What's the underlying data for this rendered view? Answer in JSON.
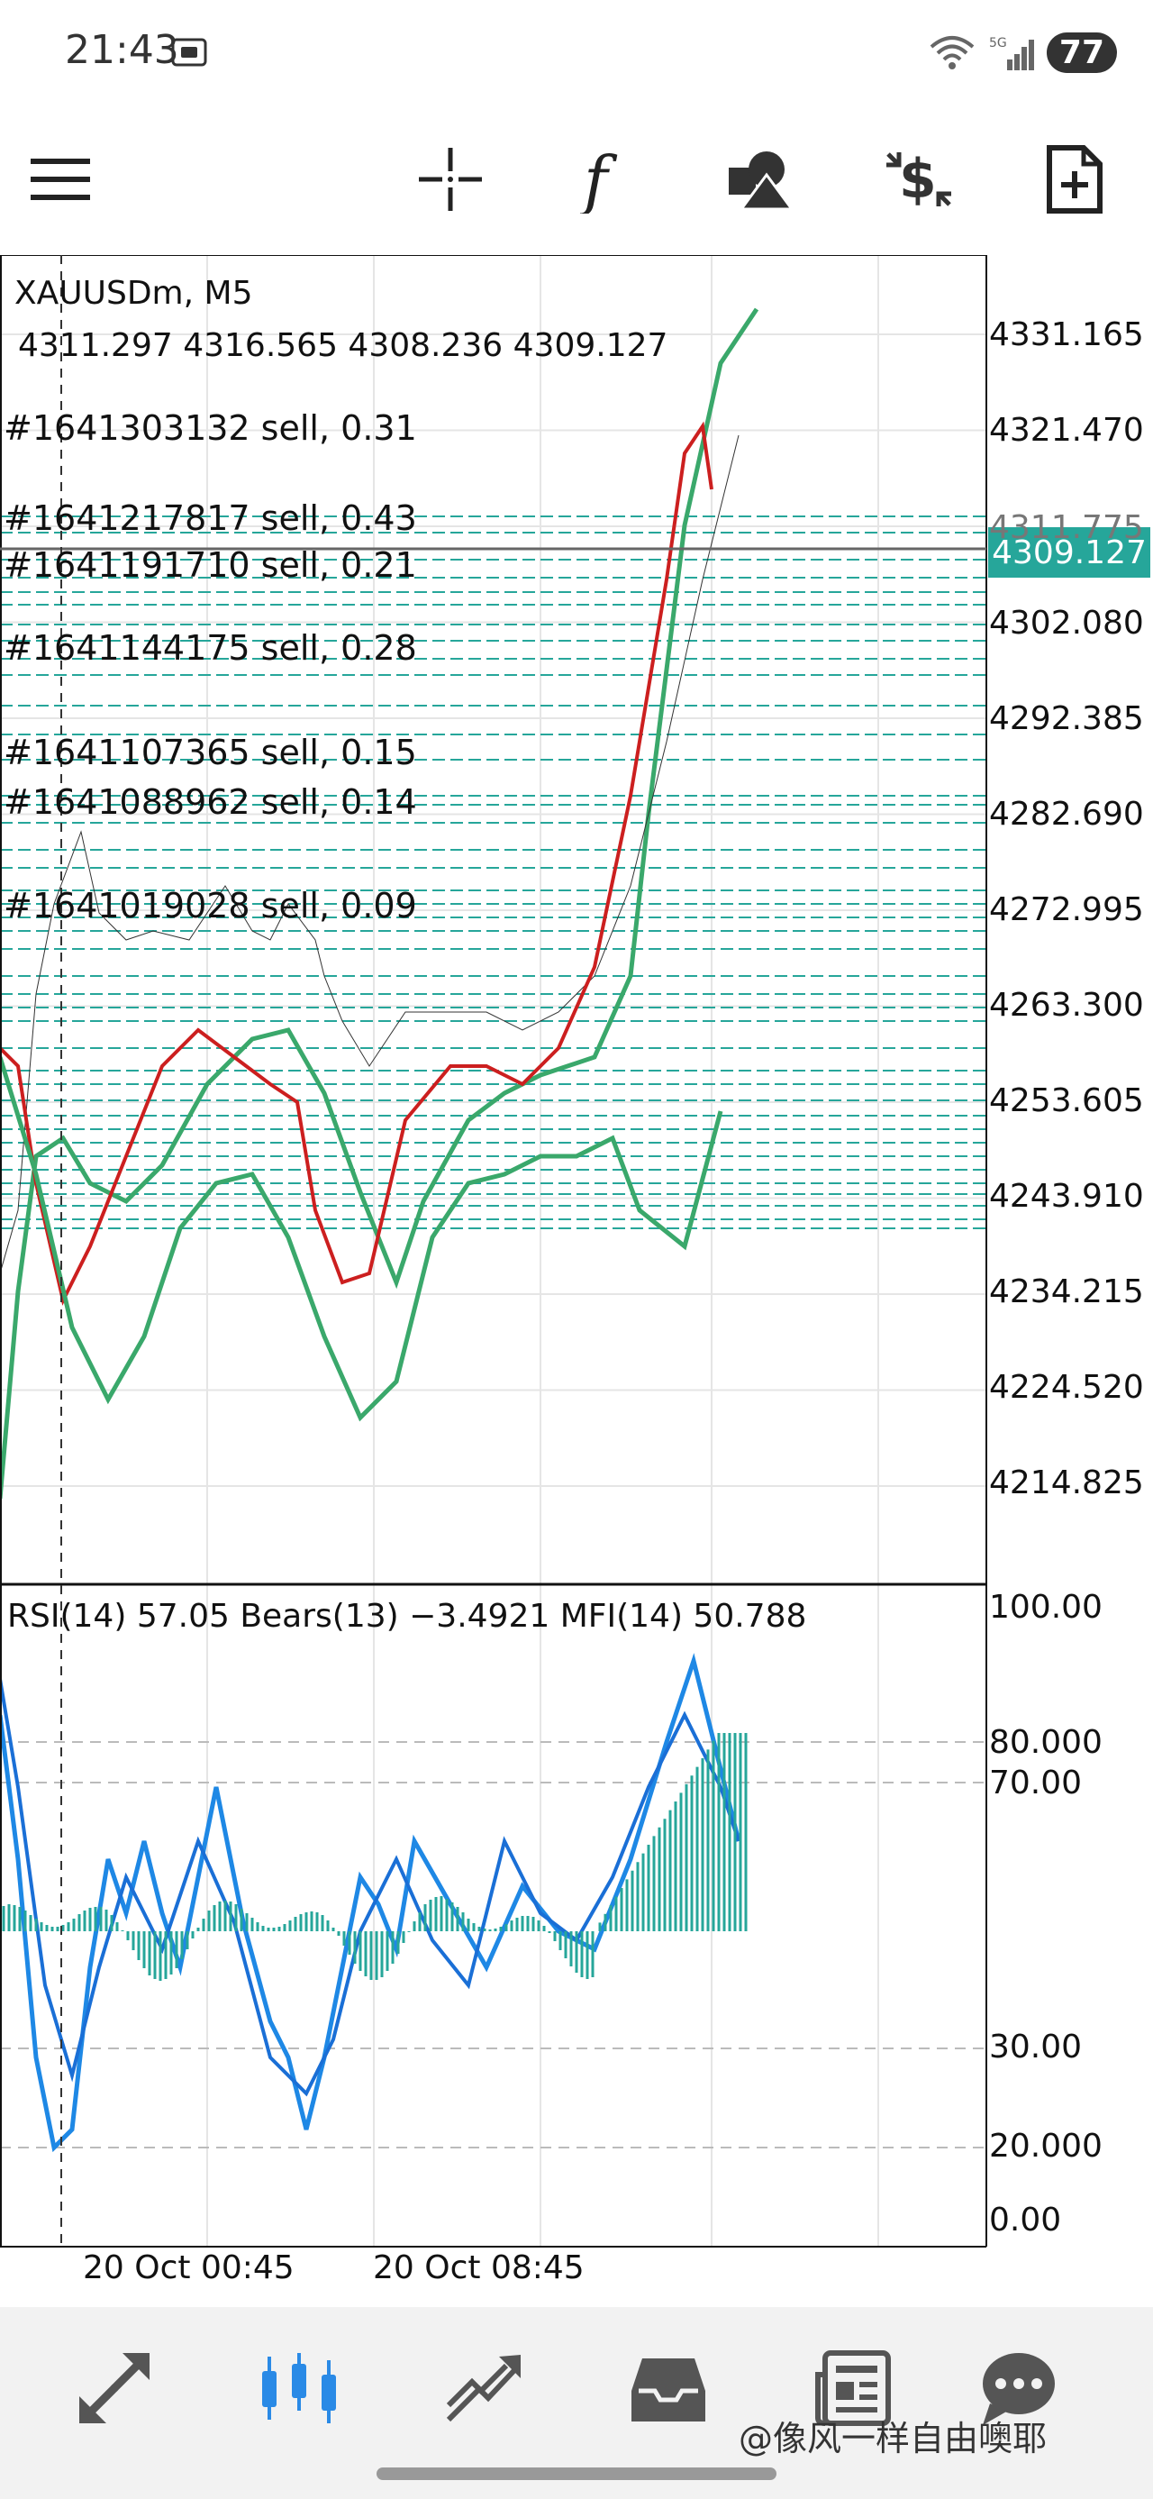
{
  "status_bar": {
    "time": "21:43",
    "network": "5G",
    "battery": "77"
  },
  "toolbar": {
    "items": [
      {
        "name": "menu-icon"
      },
      {
        "name": "crosshair-icon"
      },
      {
        "name": "indicators-icon"
      },
      {
        "name": "objects-icon"
      },
      {
        "name": "trade-icon"
      },
      {
        "name": "new-order-icon"
      }
    ]
  },
  "chart": {
    "symbol": "XAUUSDm, M5",
    "ohlc": "4311.297  4316.565  4308.236  4309.127",
    "current_price": "4309.127",
    "indicator_header": "RSI(14)  57.05  Bears(13)  −3.4921  MFI(14)  50.788",
    "orders": [
      {
        "label": "#1641303132  sell,  0.31"
      },
      {
        "label": "#1641217817  sell,  0.43"
      },
      {
        "label": "#1641191710  sell,  0.21"
      },
      {
        "label": "#1641144175  sell,  0.28"
      },
      {
        "label": "#1641107365  sell,  0.15"
      },
      {
        "label": "#1641088962  sell,  0.14"
      },
      {
        "label": "#1641019028  sell,  0.09"
      }
    ],
    "price_levels": [
      "4331.165",
      "4321.470",
      "4311.775",
      "4302.080",
      "4292.385",
      "4282.690",
      "4272.995",
      "4263.300",
      "4253.605",
      "4243.910",
      "4234.215",
      "4224.520",
      "4214.825"
    ],
    "indicator_levels": [
      "100.00",
      "80.000",
      "70.00",
      "30.00",
      "20.000",
      "0.00"
    ],
    "time_labels": [
      "20  Oct  00:45",
      "20  Oct  08:45"
    ],
    "colors": {
      "grid": "#e5e5e5",
      "bands": "#3aa86b",
      "ma": "#cc1f1f",
      "rsi": "#1e88e5",
      "bears": "#26a69a",
      "price_tag": "#26a69a"
    }
  },
  "chart_data": {
    "type": "line",
    "ylim": [
      4210,
      4336
    ],
    "close_approx": [
      4260,
      4256,
      4250,
      4238,
      4232,
      4245,
      4262,
      4268,
      4262,
      4258,
      4266,
      4264,
      4256,
      4240,
      4236,
      4244,
      4254,
      4258,
      4258,
      4256,
      4260,
      4270,
      4300,
      4322,
      4309
    ],
    "rsi_ylim": [
      0,
      100
    ]
  },
  "bottom_nav": {
    "items": [
      {
        "name": "quotes-tab"
      },
      {
        "name": "chart-tab"
      },
      {
        "name": "trade-tab"
      },
      {
        "name": "history-tab"
      },
      {
        "name": "news-tab"
      },
      {
        "name": "messages-tab"
      }
    ],
    "watermark": "@像风一样自由噢耶"
  }
}
